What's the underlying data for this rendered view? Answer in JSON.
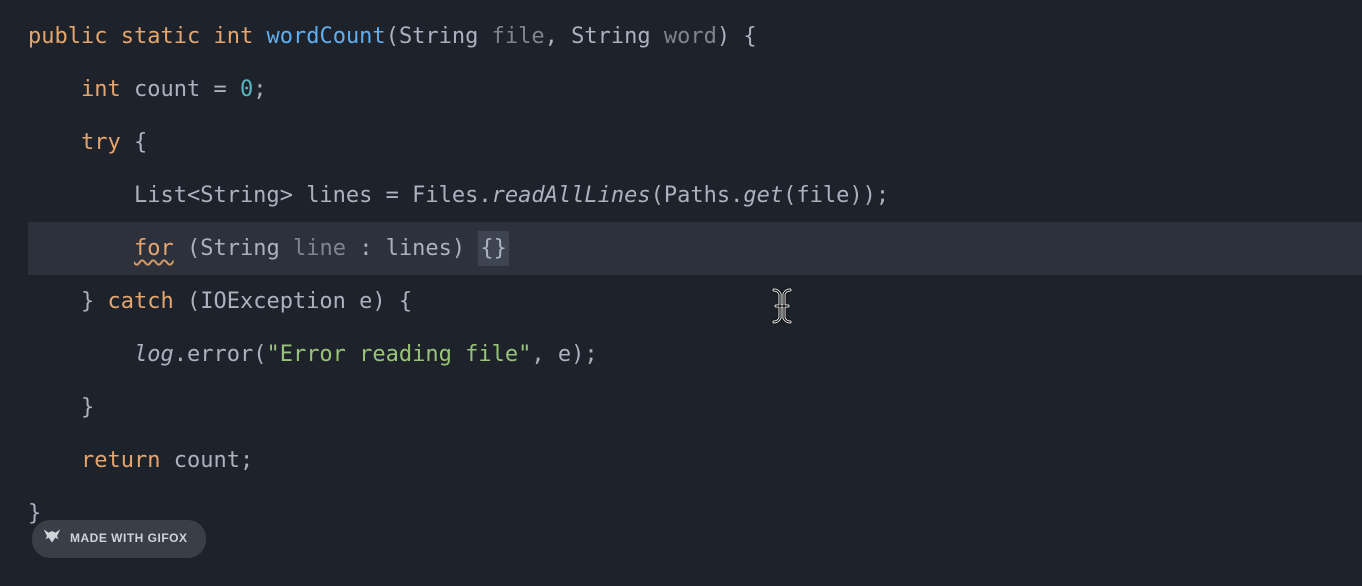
{
  "code": {
    "line1": {
      "kw_public": "public",
      "kw_static": "static",
      "kw_int": "int",
      "fn_name": "wordCount",
      "paren_open": "(",
      "param1_type": "String",
      "param1_name": "file",
      "comma": ",",
      "param2_type": "String",
      "param2_name": "word",
      "paren_close": ")",
      "brace_open": "{"
    },
    "line2": {
      "kw_int": "int",
      "var_name": "count",
      "eq": "=",
      "value": "0",
      "semi": ";"
    },
    "line3": {
      "kw_try": "try",
      "brace": "{"
    },
    "line4": {
      "type1": "List",
      "lt": "<",
      "type2": "String",
      "gt": ">",
      "var": "lines",
      "eq": "=",
      "cls": "Files",
      "dot1": ".",
      "method1": "readAllLines",
      "paren1": "(",
      "cls2": "Paths",
      "dot2": ".",
      "method2": "get",
      "paren2": "(",
      "arg": "file",
      "paren3": ")",
      "paren4": ")",
      "semi": ";"
    },
    "line5": {
      "kw_for": "for",
      "paren_open": "(",
      "type": "String",
      "var": "line",
      "colon": ":",
      "iter": "lines",
      "paren_close": ")",
      "braces": "{}"
    },
    "line6": {
      "brace_close": "}",
      "kw_catch": "catch",
      "paren_open": "(",
      "type": "IOException",
      "var": "e",
      "paren_close": ")",
      "brace_open": "{"
    },
    "line7": {
      "obj": "log",
      "dot": ".",
      "method": "error",
      "paren_open": "(",
      "str": "\"Error reading file\"",
      "comma": ",",
      "arg": "e",
      "paren_close": ")",
      "semi": ";"
    },
    "line8": {
      "brace": "}"
    },
    "line9": {
      "kw_return": "return",
      "var": "count",
      "semi": ";"
    },
    "line10": {
      "brace": "}"
    }
  },
  "badge": {
    "text": "MADE WITH GIFOX"
  }
}
